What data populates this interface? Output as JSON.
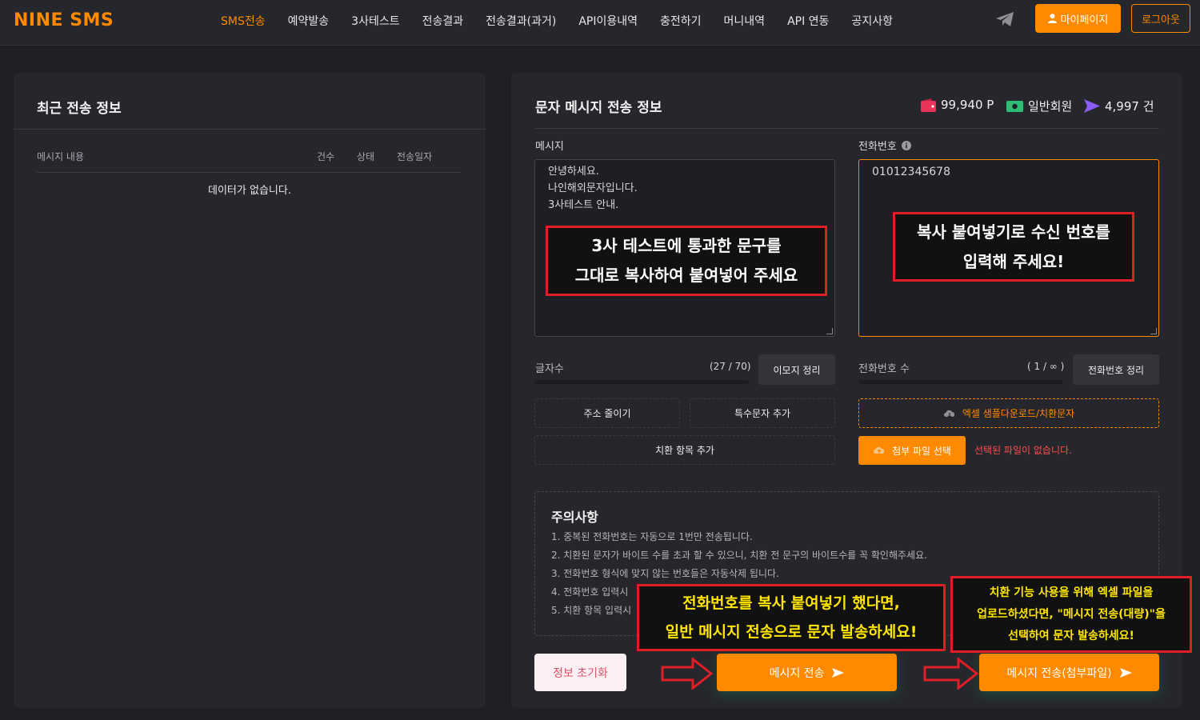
{
  "brand": "NINE SMS",
  "nav": [
    "SMS전송",
    "예약발송",
    "3사테스트",
    "전송결과",
    "전송결과(과거)",
    "API이용내역",
    "충전하기",
    "머니내역",
    "API 연동",
    "공지사항"
  ],
  "header": {
    "mypage": "마이페이지",
    "logout": "로그아웃"
  },
  "left": {
    "title": "최근 전송 정보",
    "columns": {
      "content": "메시지 내용",
      "count": "건수",
      "status": "상태",
      "date": "전송일자"
    },
    "empty": "데이터가 없습니다."
  },
  "right": {
    "title": "문자 메시지 전송 정보",
    "points": "99,940 P",
    "member": "일반회원",
    "count": "4,997 건",
    "message_label": "메시지",
    "message_lines": [
      "안녕하세요.",
      "나인해외문자입니다.",
      "3사테스트 안내."
    ],
    "phone_label": "전화번호",
    "phone_value": "01012345678",
    "charcount_label": "글자수",
    "charcount_value": "(27 / 70)",
    "emoji_btn": "이모지 정리",
    "phonecount_label": "전화번호 수",
    "phonecount_value": "( 1 / ∞ )",
    "phone_tidy_btn": "전화번호 정리",
    "shorten_btn": "주소 줄이기",
    "special_btn": "특수문자 추가",
    "replace_btn": "치환 항목 추가",
    "excel_btn": "엑셀 샘플다운로드/치환문자",
    "attach_btn": "첨부 파일 선택",
    "no_file": "선택된 파일이 없습니다.",
    "notice_title": "주의사항",
    "notices": [
      "1. 중복된 전화번호는 자동으로 1번만 전송됩니다.",
      "2. 치환된 문자가 바이트 수를 초과 할 수 있으니, 치환 전 문구의 바이트수를 꼭 확인해주세요.",
      "3. 전화번호 형식에 맞지 않는 번호들은 자동삭제 됩니다.",
      "4. 전화번호 입력시",
      "5. 치환 항목 입력시"
    ],
    "reset_btn": "정보 초기화",
    "send_btn": "메시지 전송",
    "send_attach_btn": "메시지 전송(첨부파일)"
  },
  "callouts": {
    "message": [
      "3사 테스트에 통과한 문구를",
      "그대로 복사하여 붙여넣어 주세요"
    ],
    "phone": [
      "복사 붙여넣기로 수신 번호를",
      "입력해 주세요!"
    ],
    "send": [
      "전화번호를 복사 붙여넣기 했다면,",
      "일반 메시지 전송으로 문자 발송하세요!"
    ],
    "attach": [
      "치환 기능 사용을 위해 엑셀 파일을",
      "업로드하셨다면, \"메시지 전송(대량)\"을",
      "선택하여 문자 발송하세요!"
    ]
  },
  "colors": {
    "accent": "#ff8a00",
    "annotation": "#e01e26",
    "callout_text_yellow": "#ffe600"
  }
}
